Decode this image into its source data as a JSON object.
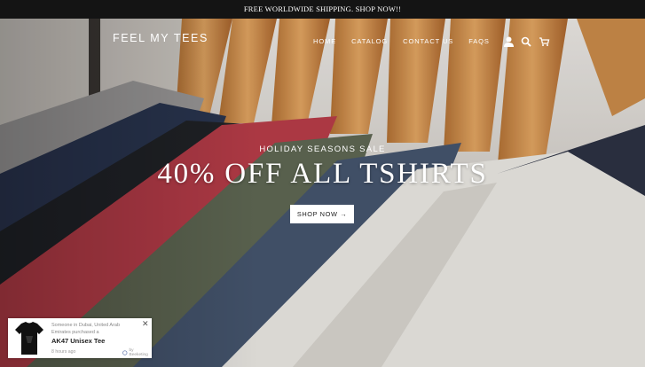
{
  "announcement": "FREE WORLDWIDE SHIPPING. SHOP NOW!!",
  "header": {
    "logo": "FEEL MY TEES",
    "nav": [
      "HOME",
      "CATALOG",
      "CONTACT US",
      "FAQS"
    ],
    "icons": [
      "account-icon",
      "search-icon",
      "cart-icon"
    ]
  },
  "hero": {
    "eyebrow": "HOLIDAY SEASONS SALE",
    "headline": "40% OFF ALL TSHIRTS",
    "cta": "SHOP NOW →"
  },
  "sales_popup": {
    "message": "Someone in Dubai, United Arab Emirates purchased a",
    "product": "AK47 Unisex Tee",
    "time": "8 hours ago",
    "credit": "by Beeketing",
    "close": "✕"
  }
}
